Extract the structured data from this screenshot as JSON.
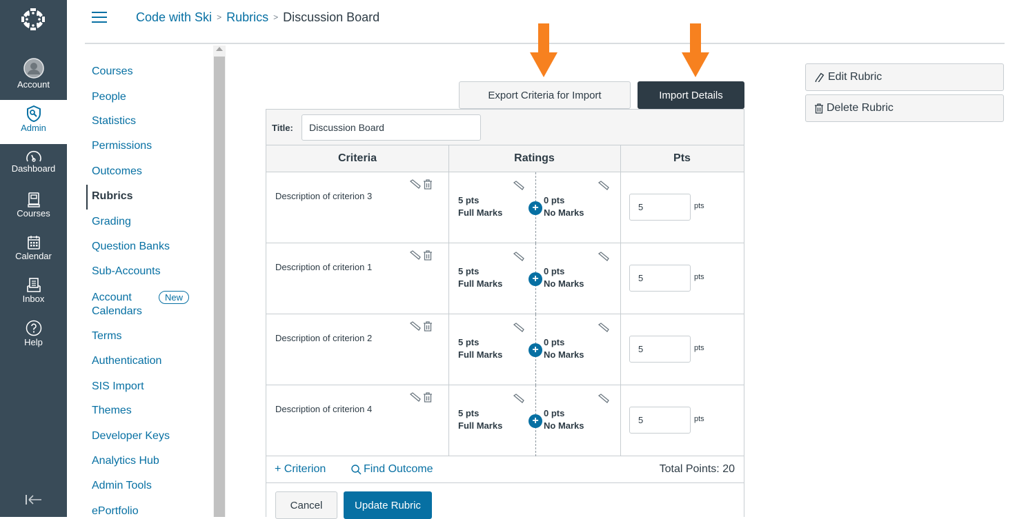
{
  "global_nav": {
    "items": [
      {
        "label": "Account",
        "icon": "account-avatar-icon"
      },
      {
        "label": "Admin",
        "icon": "admin-shield-icon",
        "active": true
      },
      {
        "label": "Dashboard",
        "icon": "dashboard-gauge-icon"
      },
      {
        "label": "Courses",
        "icon": "courses-book-icon"
      },
      {
        "label": "Calendar",
        "icon": "calendar-icon"
      },
      {
        "label": "Inbox",
        "icon": "inbox-icon"
      },
      {
        "label": "Help",
        "icon": "help-question-icon"
      }
    ],
    "collapse_icon": "collapse-nav-icon"
  },
  "header": {
    "breadcrumb": [
      "Code with Ski",
      "Rubrics",
      "Discussion Board"
    ],
    "separator": ">"
  },
  "section_nav": {
    "items": [
      {
        "label": "Courses"
      },
      {
        "label": "People"
      },
      {
        "label": "Statistics"
      },
      {
        "label": "Permissions"
      },
      {
        "label": "Outcomes"
      },
      {
        "label": "Rubrics",
        "active": true
      },
      {
        "label": "Grading"
      },
      {
        "label": "Question Banks"
      },
      {
        "label": "Sub-Accounts"
      },
      {
        "label": "Account Calendars",
        "badge": "New"
      },
      {
        "label": "Terms"
      },
      {
        "label": "Authentication"
      },
      {
        "label": "SIS Import"
      },
      {
        "label": "Themes"
      },
      {
        "label": "Developer Keys"
      },
      {
        "label": "Analytics Hub"
      },
      {
        "label": "Admin Tools"
      },
      {
        "label": "ePortfolio"
      }
    ]
  },
  "toolbar": {
    "export_label": "Export Criteria for Import",
    "import_label": "Import Details"
  },
  "sidebar_actions": {
    "edit_label": "Edit Rubric",
    "delete_label": "Delete Rubric"
  },
  "rubric": {
    "title_label": "Title:",
    "title_value": "Discussion Board",
    "columns": [
      "Criteria",
      "Ratings",
      "Pts"
    ],
    "criteria": [
      {
        "description": "Description of criterion 3",
        "ratings": [
          {
            "pts": "5 pts",
            "label": "Full Marks"
          },
          {
            "pts": "0 pts",
            "label": "No Marks"
          }
        ],
        "points": "5",
        "unit": "pts"
      },
      {
        "description": "Description of criterion 1",
        "ratings": [
          {
            "pts": "5 pts",
            "label": "Full Marks"
          },
          {
            "pts": "0 pts",
            "label": "No Marks"
          }
        ],
        "points": "5",
        "unit": "pts"
      },
      {
        "description": "Description of criterion 2",
        "ratings": [
          {
            "pts": "5 pts",
            "label": "Full Marks"
          },
          {
            "pts": "0 pts",
            "label": "No Marks"
          }
        ],
        "points": "5",
        "unit": "pts"
      },
      {
        "description": "Description of criterion 4",
        "ratings": [
          {
            "pts": "5 pts",
            "label": "Full Marks"
          },
          {
            "pts": "0 pts",
            "label": "No Marks"
          }
        ],
        "points": "5",
        "unit": "pts"
      }
    ],
    "add_criterion_label": "+ Criterion",
    "find_outcome_label": "Find Outcome",
    "total_points": "Total Points: 20",
    "cancel_label": "Cancel",
    "update_label": "Update Rubric"
  },
  "colors": {
    "nav_bg": "#394b58",
    "link": "#0770a3",
    "dark_button": "#2d3b45",
    "primary_button": "#0770a3",
    "annotation_arrow": "#f7811f"
  }
}
